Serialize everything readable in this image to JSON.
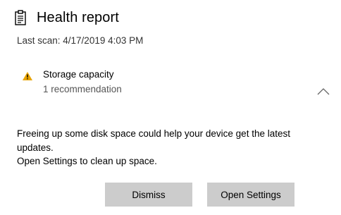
{
  "header": {
    "icon": "clipboard-report-icon",
    "title": "Health report"
  },
  "last_scan": "Last scan: 4/17/2019 4:03 PM",
  "item": {
    "icon": "warning-icon",
    "icon_color": "#e8a400",
    "title": "Storage capacity",
    "subtitle": "1 recommendation",
    "toggle_icon": "chevron-up-icon"
  },
  "details": {
    "line1": "Freeing up some disk space could help your device get the latest updates.",
    "line2": "Open Settings to clean up space."
  },
  "buttons": {
    "dismiss": "Dismiss",
    "open_settings": "Open Settings",
    "color": "#cccccc"
  }
}
